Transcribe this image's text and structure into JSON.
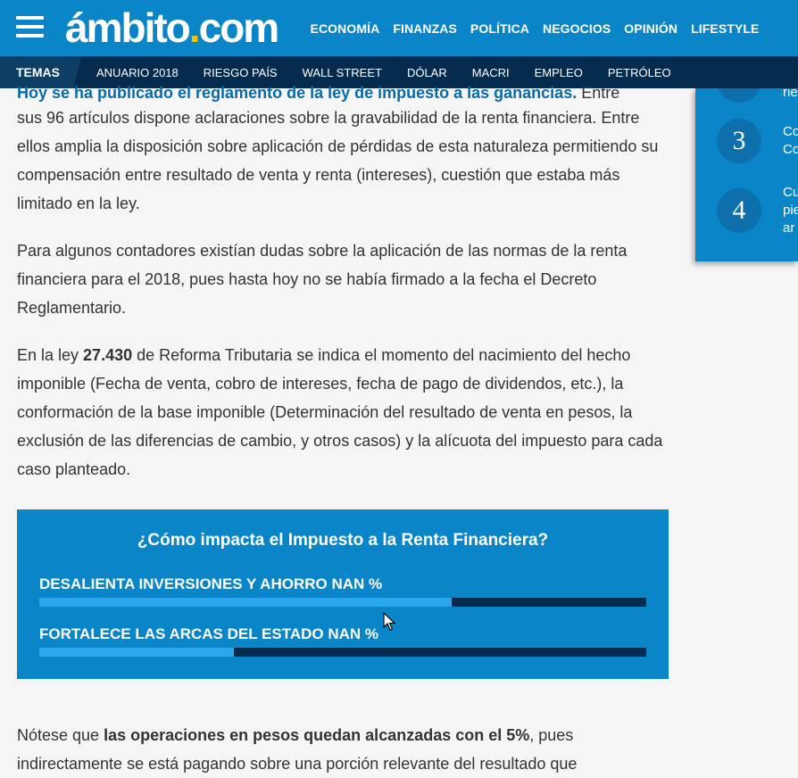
{
  "header": {
    "logo_main": "ámbito",
    "logo_dot": ".",
    "logo_tld": "com",
    "nav": [
      "ECONOMÍA",
      "FINANZAS",
      "POLÍTICA",
      "NEGOCIOS",
      "OPINIÓN",
      "LIFESTYLE"
    ]
  },
  "topics": {
    "label": "TEMAS",
    "items": [
      "ANUARIO 2018",
      "RIESGO PAÍS",
      "WALL STREET",
      "DÓLAR",
      "MACRI",
      "EMPLEO",
      "PETRÓLEO"
    ]
  },
  "article": {
    "cut_line_link": "Hoy se ha publicado el reglamento de la ley de impuesto a las ganancias.",
    "cut_line_tail": " Entre",
    "p1": "sus 96 artículos dispone aclaraciones sobre la gravabilidad de la renta financiera. Entre ellos amplia la disposición sobre aplicación de pérdidas de esta naturaleza permitiendo su compensación entre resultado de venta y renta (intereses), cuestión que estaba más limitado en la ley.",
    "p2": "Para algunos contadores existían dudas sobre la aplicación de las normas de la renta financiera para el 2018, pues hasta hoy no se había firmado a la fecha el Decreto Reglamentario.",
    "p3_pre": "En la ley ",
    "p3_bold": "27.430",
    "p3_post": " de Reforma Tributaria se indica el momento del nacimiento del hecho imponible (Fecha de venta, cobro de intereses, fecha de pago de dividendos, etc.), la conformación de la base imponible (Determinación del resultado de venta en pesos, la exclusión de las diferencias de cambio, y otros casos) y la alícuota del impuesto para cada caso planteado.",
    "p4_pre": "Nótese que ",
    "p4_bold": "las operaciones en pesos quedan alcanzadas con el 5%",
    "p4_post": ", pues indirectamente se está pagando sobre una porción relevante del resultado que"
  },
  "sidebar": {
    "items": [
      {
        "num": "",
        "text": "rie"
      },
      {
        "num": "3",
        "text": "Co\nCo"
      },
      {
        "num": "4",
        "text": "Cu\npie\nar"
      }
    ]
  },
  "poll": {
    "title": "¿Cómo impacta el Impuesto a la Renta Financiera?",
    "options": [
      {
        "label": "DESALIENTA INVERSIONES Y AHORRO NAN %",
        "fill_fraction": 0.68
      },
      {
        "label": "FORTALECE LAS ARCAS DEL ESTADO NAN %",
        "fill_fraction": 0.32
      }
    ]
  },
  "colors": {
    "brand_blue": "#0a86c8",
    "dark_navy": "#052c4f",
    "poll_fill": "#2aa7ee",
    "logo_dot": "#f5c400"
  }
}
